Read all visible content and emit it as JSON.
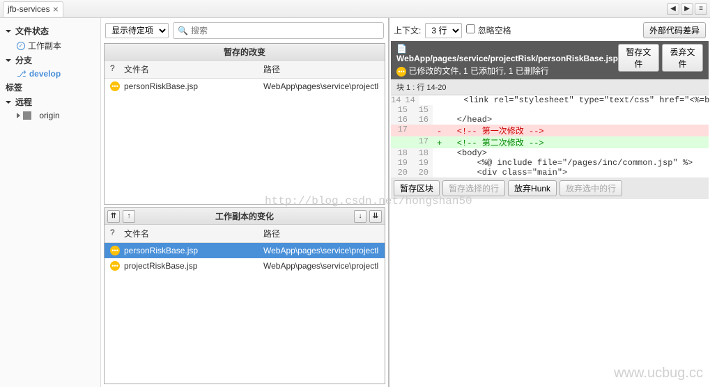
{
  "tab": {
    "title": "jfb-services"
  },
  "sidebar": {
    "sections": [
      {
        "label": "文件状态",
        "sub": [
          {
            "label": "工作副本",
            "icon": "check"
          }
        ]
      },
      {
        "label": "分支",
        "sub": [
          {
            "label": "develop",
            "icon": "branch"
          }
        ]
      },
      {
        "label": "标签",
        "sub": []
      },
      {
        "label": "远程",
        "sub": [
          {
            "label": "origin",
            "icon": "server"
          }
        ]
      }
    ]
  },
  "center": {
    "pending_select": "显示待定项",
    "search_placeholder": "搜索",
    "staged": {
      "title": "暂存的改变",
      "columns": [
        "?",
        "文件名",
        "路径"
      ],
      "rows": [
        {
          "status": "modified",
          "name": "personRiskBase.jsp",
          "path": "WebApp\\pages\\service\\projectl"
        }
      ]
    },
    "working": {
      "title": "工作副本的变化",
      "columns": [
        "?",
        "文件名",
        "路径"
      ],
      "rows": [
        {
          "status": "modified",
          "name": "personRiskBase.jsp",
          "path": "WebApp\\pages\\service\\projectl",
          "selected": true
        },
        {
          "status": "modified",
          "name": "projectRiskBase.jsp",
          "path": "WebApp\\pages\\service\\projectl",
          "selected": false
        }
      ]
    }
  },
  "right": {
    "context_label": "上下文:",
    "context_value": "3 行",
    "ignore_ws": "忽略空格",
    "ext_diff": "外部代码差异",
    "file_path": "WebApp/pages/service/projectRisk/personRiskBase.jsp",
    "file_status": "已修改的文件, 1 已添加行, 1 已删除行",
    "stage_file": "暂存文件",
    "discard_file": "丢弃文件",
    "hunk_header": "块 1 : 行 14-20",
    "code": [
      {
        "old": "14",
        "new": "14",
        "type": "ctx",
        "text": "        <link rel=\"stylesheet\" type=\"text/css\" href=\"<%=basePath %>/s"
      },
      {
        "old": "15",
        "new": "15",
        "type": "ctx",
        "text": ""
      },
      {
        "old": "16",
        "new": "16",
        "type": "ctx",
        "text": "    </head>"
      },
      {
        "old": "17",
        "new": "",
        "type": "del",
        "text": "-   <!-- 第一次修改 -->"
      },
      {
        "old": "",
        "new": "17",
        "type": "add",
        "text": "+   <!-- 第二次修改 -->"
      },
      {
        "old": "18",
        "new": "18",
        "type": "ctx",
        "text": "    <body>"
      },
      {
        "old": "19",
        "new": "19",
        "type": "ctx",
        "text": "        <%@ include file=\"/pages/inc/common.jsp\" %>"
      },
      {
        "old": "20",
        "new": "20",
        "type": "ctx",
        "text": "        <div class=\"main\">"
      }
    ],
    "hunk_buttons": {
      "stage_hunk": "暂存区块",
      "stage_sel": "暂存选择的行",
      "discard_hunk": "放弃Hunk",
      "discard_sel": "放弃选中的行"
    }
  },
  "watermark": "http://blog.csdn.net/hongshan50",
  "watermark2": "www.ucbug.cc"
}
